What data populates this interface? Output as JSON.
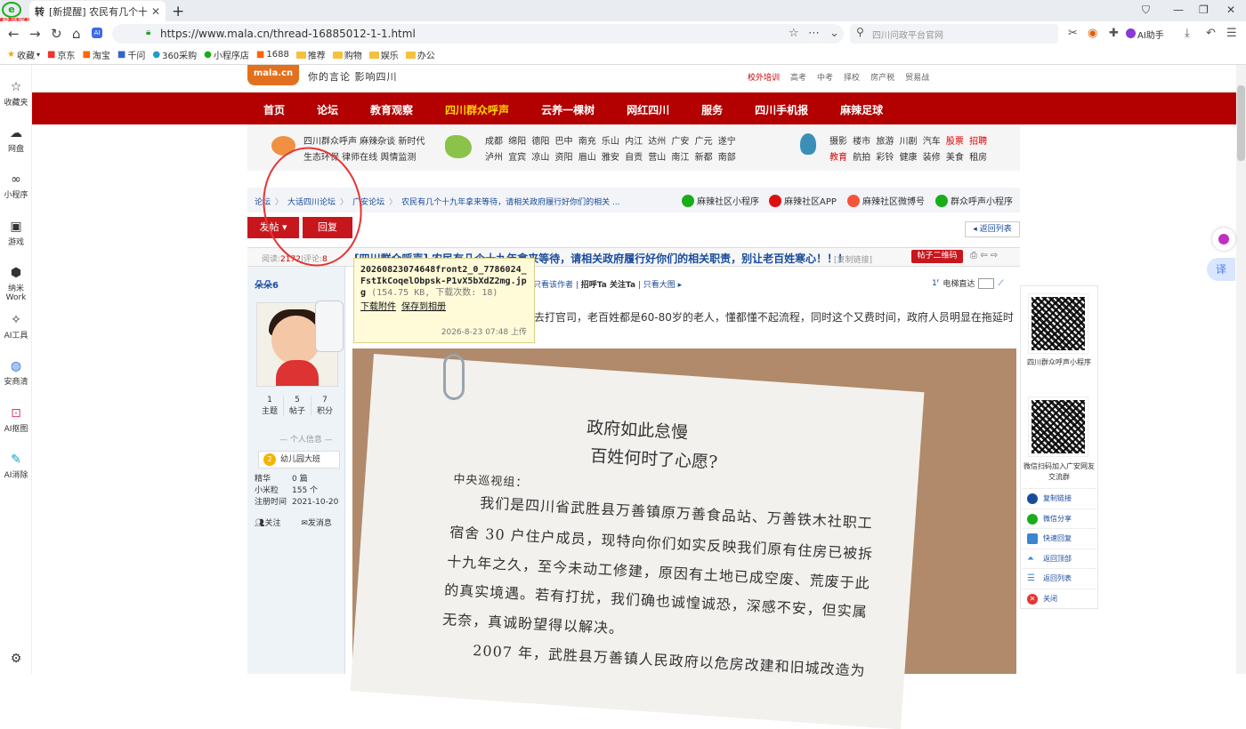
{
  "browser": {
    "tab_title": "[新提醒] 农民有几个十九年",
    "tab_favicon": "转",
    "brand_logo": "e",
    "login_badge": "登录账号",
    "url": "https://www.mala.cn/thread-16885012-1-1.html",
    "search_placeholder": "四川问政平台官网",
    "ai_helper": "AI助手",
    "bookmarks": [
      "收藏",
      "京东",
      "淘宝",
      "千问",
      "360采购",
      "小程序店",
      "1688",
      "推荐",
      "购物",
      "娱乐",
      "办公"
    ]
  },
  "left_sidebar": [
    {
      "label": "收藏夹",
      "icon": "star-icon"
    },
    {
      "label": "网盘",
      "icon": "cloud-icon"
    },
    {
      "label": "小程序",
      "icon": "link-icon"
    },
    {
      "label": "游戏",
      "icon": "gamepad-icon"
    },
    {
      "label": "纳米Work",
      "icon": "nano-icon"
    },
    {
      "label": "AI工具",
      "icon": "sparkle-icon"
    },
    {
      "label": "安商清",
      "icon": "shield-icon"
    },
    {
      "label": "AI抠图",
      "icon": "crop-icon"
    },
    {
      "label": "AI消除",
      "icon": "eraser-icon"
    }
  ],
  "site": {
    "logo_text": "mala.cn",
    "slogan": "你的言论 影响四川",
    "top_links": [
      "校外培训",
      "高考",
      "中考",
      "择校",
      "房产税",
      "贸易战"
    ],
    "nav": [
      "首页",
      "论坛",
      "教育观察",
      "四川群众呼声",
      "云养一棵树",
      "网红四川",
      "服务",
      "四川手机报",
      "麻辣足球"
    ],
    "nav_highlight": "四川群众呼声",
    "panel_line1": "四川群众呼声 麻辣杂谈 新时代",
    "panel_line2": "生态环保 律师在线 舆情监测",
    "cities_line1": "成都 绵阳 德阳 巴中 南充 乐山 内江 达州 广安 广元 遂宁",
    "cities_line2": "泸州 宜宾 凉山 资阳 眉山 雅安 自贡 营山 南江 新都 南部",
    "cats_line1_a": "摄影 楼市 旅游 川剧 汽车",
    "cats_line1_b": "股票 招聘",
    "cats_line2_a": "教育",
    "cats_line2_b": "航拍 彩铃 健康 装修 美食 租房"
  },
  "breadcrumb": [
    "论坛",
    "大话四川论坛",
    "广安论坛",
    "农民有几个十九年拿来等待，请相关政府履行好你们的相关 ..."
  ],
  "social_links": [
    "麻辣社区小程序",
    "麻辣社区APP",
    "麻辣社区微博号",
    "群众呼声小程序"
  ],
  "buttons": {
    "post": "发帖",
    "reply": "回复",
    "back_list": "返回列表"
  },
  "thread": {
    "views_label": "阅读:",
    "views": "2172",
    "replies_label": "|评论:",
    "replies": "8",
    "title": "[四川群众呼声] 农民有几个十九年拿来等待，请相关政府履行好你们的相关职责，别让老百姓寒心！！！",
    "copy_link": "[复制链接]",
    "qr_button": "帖子二维码",
    "post_options": "只看该作者",
    "post_options_b": "招呼Ta 关注Ta",
    "post_options_c": "只看大图",
    "e_read": "电梯直达",
    "body_line": "去打官司，老百姓都是60-80岁的老人，懂都懂不起流程，同时这个又费时间，政府人员明显在拖延时"
  },
  "author": {
    "name": "朵朵6",
    "topics": "1",
    "topics_label": "主题",
    "posts": "5",
    "posts_label": "帖子",
    "points": "7",
    "points_label": "积分",
    "info_label": "个人信息",
    "rank": "幼儿园大班",
    "rank_level": "2",
    "essence_label": "精华",
    "essence": "0 篇",
    "mibi_label": "小米粒",
    "mibi": "155 个",
    "reg_label": "注册时间",
    "reg": "2021-10-20",
    "follow": "关注",
    "message": "发消息"
  },
  "tooltip": {
    "filename": "20260823074648front2_0_7786024_FstIkCoqelObpsk-P1vX5bXdZ2mg.jpg",
    "meta": "(154.75 KB, 下载次数: 18)",
    "download": "下载附件",
    "save": "保存到相册",
    "date": "2026-8-23 07:48 上传"
  },
  "document": {
    "title1": "政府如此怠慢",
    "title2": "百姓何时了心愿?",
    "lines": [
      "中央巡视组：",
      "我们是四川省武胜县万善镇原万善食品站、万善铁木社职工",
      "宿舍 30 户住户成员，现特向你们如实反映我们原有住房已被拆",
      "十九年之久，至今未动工修建，原因有土地已成空废、荒废于此",
      "的真实境遇。若有打扰，我们确也诚惶诚恐，深感不安，但实属",
      "无奈，真诚盼望得以解决。",
      "2007 年，武胜县万善镇人民政府以危房改建和旧城改造为"
    ]
  },
  "right_panel": {
    "qr1_caption": "四川群众呼声小程序",
    "qr2_caption": "微信扫码加入广安网友交流群",
    "actions": [
      "复制链接",
      "微信分享",
      "快速回复",
      "返回顶部",
      "返回列表",
      "关闭"
    ]
  }
}
